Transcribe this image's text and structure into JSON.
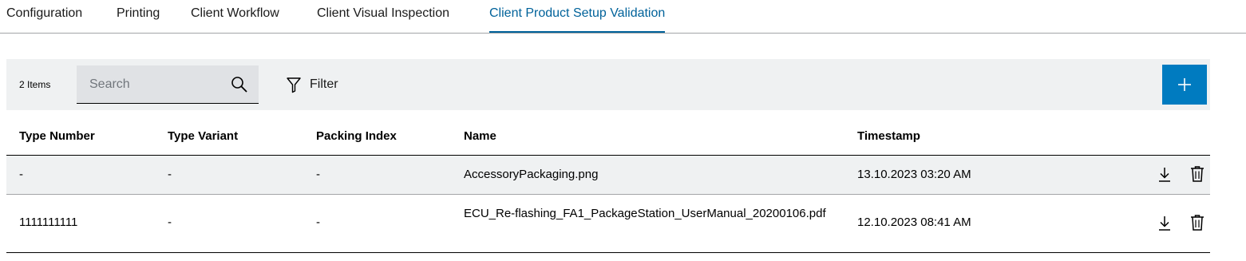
{
  "tabs": [
    {
      "label": "Configuration",
      "active": false
    },
    {
      "label": "Printing",
      "active": false
    },
    {
      "label": "Client Workflow",
      "active": false
    },
    {
      "label": "Client Visual Inspection",
      "active": false
    },
    {
      "label": "Client Product Setup Validation",
      "active": true
    }
  ],
  "toolbar": {
    "count": "2 Items",
    "search_placeholder": "Search",
    "search_value": "",
    "filter_label": "Filter",
    "add_icon": "plus-icon",
    "accent": "#007bc0"
  },
  "table": {
    "columns": [
      "Type Number",
      "Type Variant",
      "Packing Index",
      "Name",
      "Timestamp"
    ],
    "rows": [
      {
        "type_number": "-",
        "type_variant": "-",
        "packing_index": "-",
        "name": "AccessoryPackaging.png",
        "timestamp": "13.10.2023 03:20 AM"
      },
      {
        "type_number": "1111111111",
        "type_variant": "-",
        "packing_index": "-",
        "name": "ECU_Re-flashing_FA1_PackageStation_UserManual_20200106.pdf",
        "timestamp": "12.10.2023 08:41 AM"
      }
    ],
    "row_actions": [
      "download-icon",
      "delete-icon"
    ]
  }
}
